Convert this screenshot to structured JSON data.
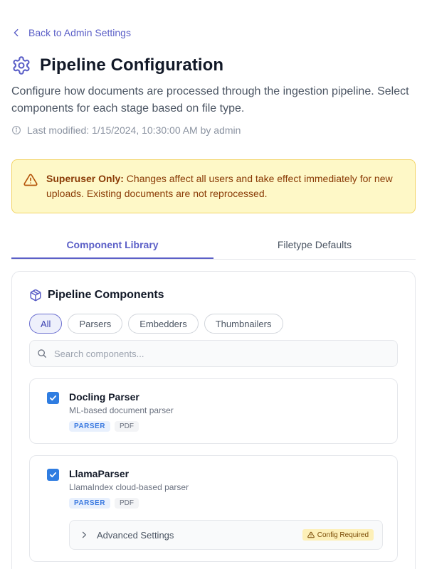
{
  "nav": {
    "back_label": "Back to Admin Settings"
  },
  "header": {
    "title": "Pipeline Configuration",
    "description": "Configure how documents are processed through the ingestion pipeline. Select components for each stage based on file type.",
    "last_modified": "Last modified: 1/15/2024, 10:30:00 AM by admin"
  },
  "alert": {
    "strong": "Superuser Only:",
    "text": " Changes affect all users and take effect immediately for new uploads. Existing documents are not reprocessed."
  },
  "tabs": [
    {
      "label": "Component Library",
      "active": true
    },
    {
      "label": "Filetype Defaults",
      "active": false
    }
  ],
  "card": {
    "title": "Pipeline Components",
    "filters": [
      {
        "label": "All",
        "active": true
      },
      {
        "label": "Parsers",
        "active": false
      },
      {
        "label": "Embedders",
        "active": false
      },
      {
        "label": "Thumbnailers",
        "active": false
      }
    ],
    "search_placeholder": "Search components...",
    "components": [
      {
        "name": "Docling Parser",
        "description": "ML-based document parser",
        "type_tag": "PARSER",
        "filetype_tag": "PDF",
        "checked": true
      },
      {
        "name": "LlamaParser",
        "description": "LlamaIndex cloud-based parser",
        "type_tag": "PARSER",
        "filetype_tag": "PDF",
        "checked": true,
        "advanced_label": "Advanced Settings",
        "config_badge": "Config Required"
      }
    ]
  },
  "colors": {
    "accent": "#5b5fc7",
    "checkbox": "#2f7de1",
    "warning_bg": "#fef8c7",
    "warning_text": "#8a3b06"
  }
}
